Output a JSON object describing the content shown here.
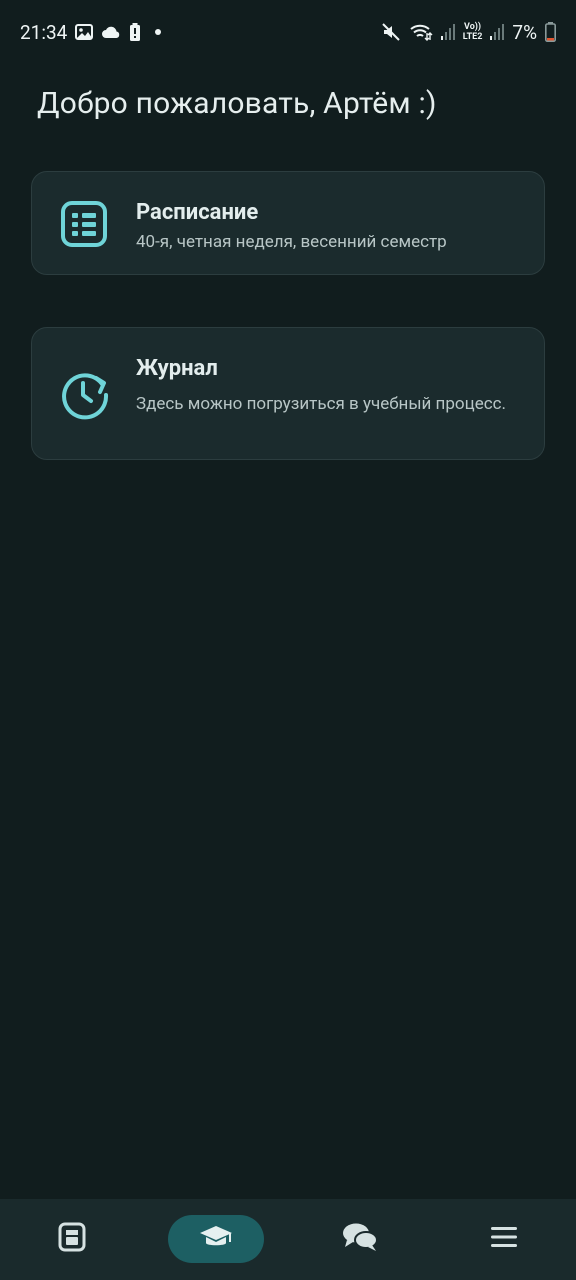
{
  "status_bar": {
    "time": "21:34",
    "battery_percent": "7%",
    "left_icons": [
      "gallery-icon",
      "cloud-icon",
      "battery-alert-icon",
      "dot-icon"
    ],
    "right_icons": [
      "mute-icon",
      "wifi-icon",
      "signal-icon",
      "volte-lte2-icon",
      "signal-icon",
      "battery-icon"
    ],
    "volte_label": "Vo))",
    "lte_label": "LTE2"
  },
  "greeting": "Добро пожаловать, Артём :)",
  "cards": [
    {
      "icon": "schedule-list-icon",
      "title": "Расписание",
      "subtitle": "40-я, четная неделя, весенний семестр"
    },
    {
      "icon": "history-clock-icon",
      "title": "Журнал",
      "subtitle": "Здесь можно погрузиться в учебный процесс."
    }
  ],
  "bottom_nav": {
    "items": [
      {
        "icon": "dashboard-icon",
        "active": false
      },
      {
        "icon": "graduation-cap-icon",
        "active": true
      },
      {
        "icon": "chat-icon",
        "active": false
      },
      {
        "icon": "menu-icon",
        "active": false
      }
    ]
  },
  "colors": {
    "background": "#111d1e",
    "card": "#1b2b2d",
    "accent": "#6fd4d8",
    "nav_active": "#1d5f63"
  }
}
